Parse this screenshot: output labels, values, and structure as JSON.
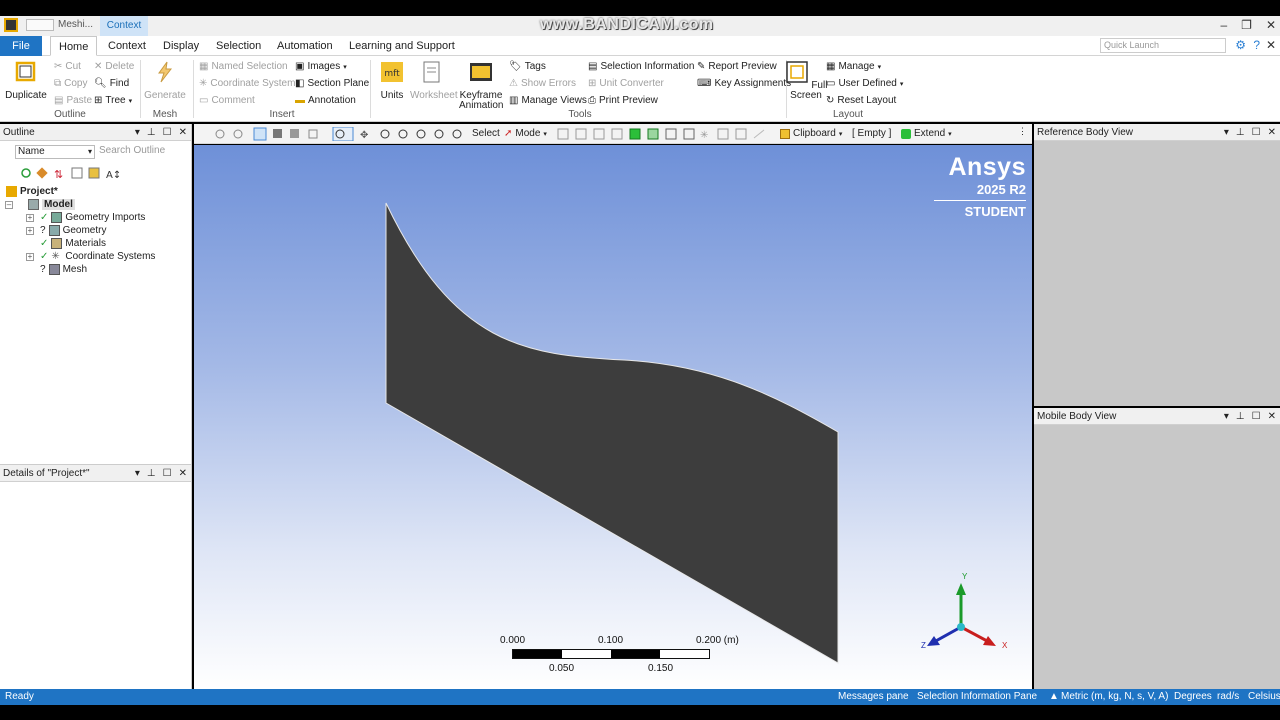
{
  "watermark": "www.BANDICAM.com",
  "titlebar": {
    "tab_mesh": "Meshi...",
    "tab_context": "Context",
    "minimize": "–",
    "restore": "❐",
    "close": "✕"
  },
  "menu": {
    "file": "File",
    "tabs": [
      "Home",
      "Context",
      "Display",
      "Selection",
      "Automation",
      "Learning and Support"
    ],
    "quick_launch_placeholder": "Quick Launch",
    "close": "✕"
  },
  "ribbon": {
    "outline": {
      "duplicate": "Duplicate",
      "cut": "Cut",
      "copy": "Copy",
      "paste": "Paste",
      "delete": "Delete",
      "find": "Find",
      "tree": "Tree",
      "group": "Outline"
    },
    "mesh": {
      "generate": "Generate",
      "group": "Mesh"
    },
    "insert": {
      "named_selection": "Named Selection",
      "coordinate_system": "Coordinate System",
      "comment": "Comment",
      "images": "Images",
      "section_plane": "Section Plane",
      "annotation": "Annotation",
      "group": "Insert"
    },
    "tools": {
      "units": "Units",
      "worksheet": "Worksheet",
      "keyframe": "Keyframe",
      "animation": "Animation",
      "tags": "Tags",
      "show_errors": "Show Errors",
      "manage_views": "Manage Views",
      "selection_information": "Selection Information",
      "unit_converter": "Unit Converter",
      "print_preview": "Print Preview",
      "report_preview": "Report Preview",
      "key_assignments": "Key Assignments",
      "group": "Tools"
    },
    "layout": {
      "full": "Full",
      "screen": "Screen",
      "manage": "Manage",
      "user_defined": "User Defined",
      "reset_layout": "Reset Layout",
      "group": "Layout"
    }
  },
  "toolbar": {
    "select": "Select",
    "mode": "Mode",
    "clipboard": "Clipboard",
    "empty": "[ Empty ]",
    "extend": "Extend"
  },
  "outline": {
    "title": "Outline",
    "filter": "Name",
    "search_placeholder": "Search Outline",
    "tree": {
      "project": "Project*",
      "model": "Model",
      "geometry_imports": "Geometry Imports",
      "geometry": "Geometry",
      "materials": "Materials",
      "coordinate_systems": "Coordinate Systems",
      "mesh": "Mesh"
    }
  },
  "details": {
    "title": "Details of \"Project*\""
  },
  "viewport": {
    "brand": "Ansys",
    "version": "2025 R2",
    "edition": "STUDENT",
    "scale_top": [
      "0.000",
      "0.100",
      "0.200 (m)"
    ],
    "scale_bottom": [
      "0.050",
      "0.150"
    ],
    "axes": {
      "y": "Y",
      "x": "X",
      "z": "Z"
    }
  },
  "panes": {
    "reference_body": "Reference Body View",
    "mobile_body": "Mobile Body View"
  },
  "status": {
    "ready": "Ready",
    "messages": "Messages pane",
    "selection_info": "Selection Information Pane",
    "units": "Metric (m, kg, N, s, V, A)",
    "degrees": "Degrees",
    "rads": "rad/s",
    "celsius": "Celsius"
  },
  "colors": {
    "accent": "#1f74c4",
    "body": "#3d3d3d",
    "viewport_top": "#6e90d8"
  }
}
